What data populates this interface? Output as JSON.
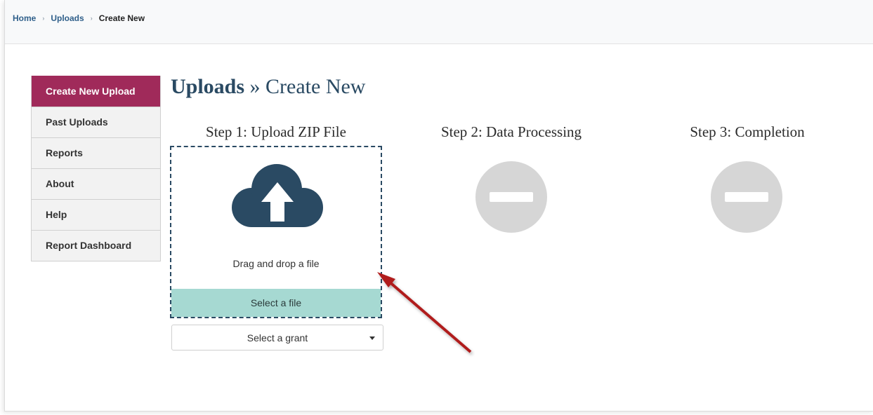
{
  "breadcrumb": {
    "items": [
      {
        "label": "Home"
      },
      {
        "label": "Uploads"
      },
      {
        "label": "Create New"
      }
    ],
    "separator": "›"
  },
  "sidebar": {
    "items": [
      {
        "label": "Create New Upload",
        "active": true
      },
      {
        "label": "Past Uploads"
      },
      {
        "label": "Reports"
      },
      {
        "label": "About"
      },
      {
        "label": "Help"
      },
      {
        "label": "Report Dashboard"
      }
    ]
  },
  "page": {
    "title_bold": "Uploads",
    "title_sep": "»",
    "title_rest": "Create New"
  },
  "steps": [
    {
      "title": "Step 1: Upload ZIP File"
    },
    {
      "title": "Step 2: Data Processing"
    },
    {
      "title": "Step 3: Completion"
    }
  ],
  "dropzone": {
    "text": "Drag and drop a file",
    "button_label": "Select a file",
    "icon": "cloud-upload-icon"
  },
  "grant_select": {
    "value": "Select a grant"
  },
  "colors": {
    "accent": "#a02a5a",
    "primary": "#2a4a63",
    "select_file_bg": "#a6d9d2",
    "pending": "#d6d6d6",
    "annotation_arrow": "#b01a1a"
  }
}
